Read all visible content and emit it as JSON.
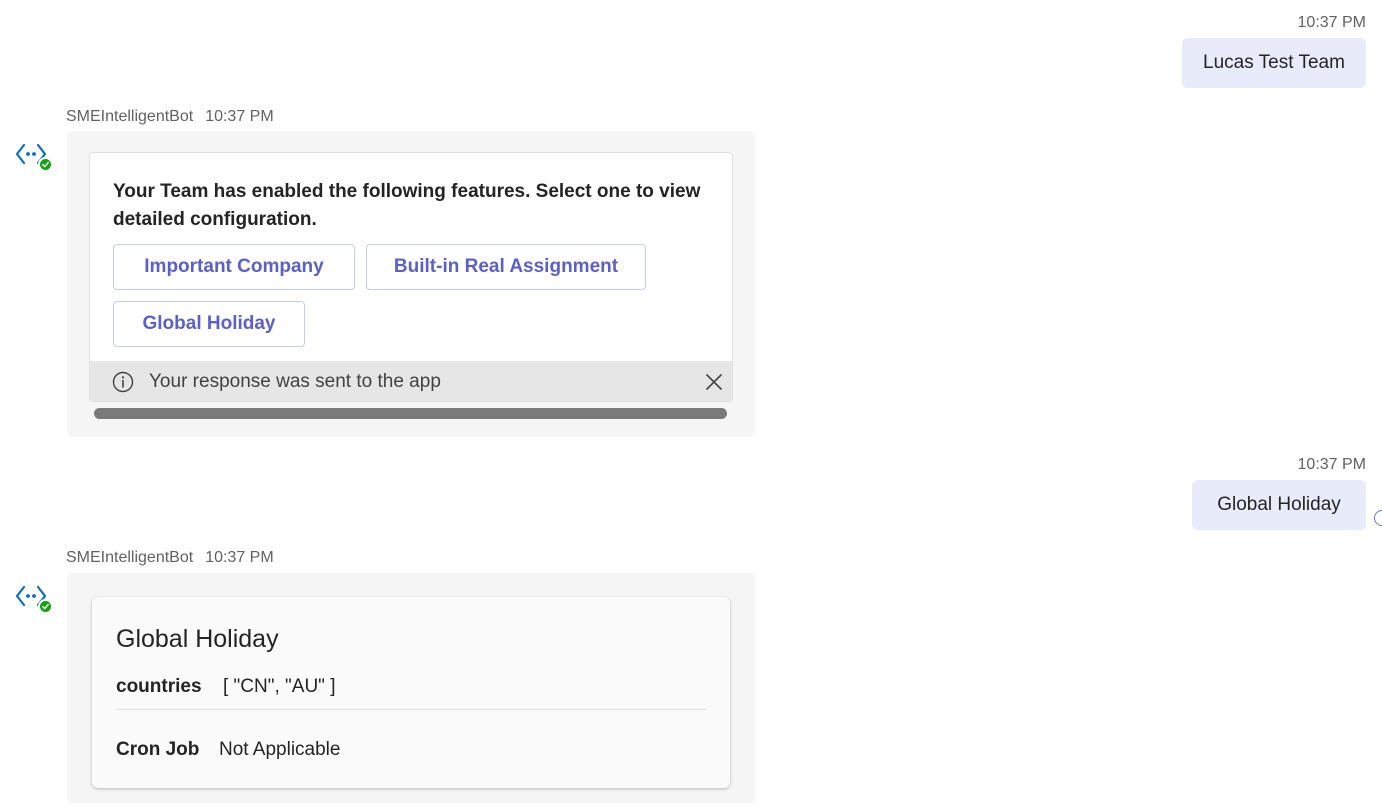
{
  "messages": {
    "user1": {
      "time": "10:37 PM",
      "text": "Lucas Test Team"
    },
    "bot1": {
      "sender": "SMEIntelligentBot",
      "time": "10:37 PM",
      "card": {
        "description": "Your Team has enabled the following features. Select one to view detailed configuration.",
        "actions": [
          "Important Company",
          "Built-in Real Assignment",
          "Global Holiday"
        ],
        "info_text": "Your response was sent to the app"
      }
    },
    "user2": {
      "time": "10:37 PM",
      "text": "Global Holiday"
    },
    "bot2": {
      "sender": "SMEIntelligentBot",
      "time": "10:37 PM",
      "card": {
        "title": "Global Holiday",
        "facts": [
          {
            "label": "countries",
            "value": "[ \"CN\", \"AU\" ]"
          },
          {
            "label": "Cron Job",
            "value": "Not Applicable"
          }
        ]
      }
    }
  },
  "colors": {
    "user_bubble": "#e8ebfa",
    "bot_bubble": "#f5f5f5",
    "accent": "#5b5fc7",
    "bot_icon": "#0f6cbd",
    "presence_online": "#13a10e"
  },
  "icons": {
    "bot_avatar": "bot-code-icon",
    "presence": "checkmark-icon",
    "info": "info-icon",
    "close": "close-icon"
  }
}
